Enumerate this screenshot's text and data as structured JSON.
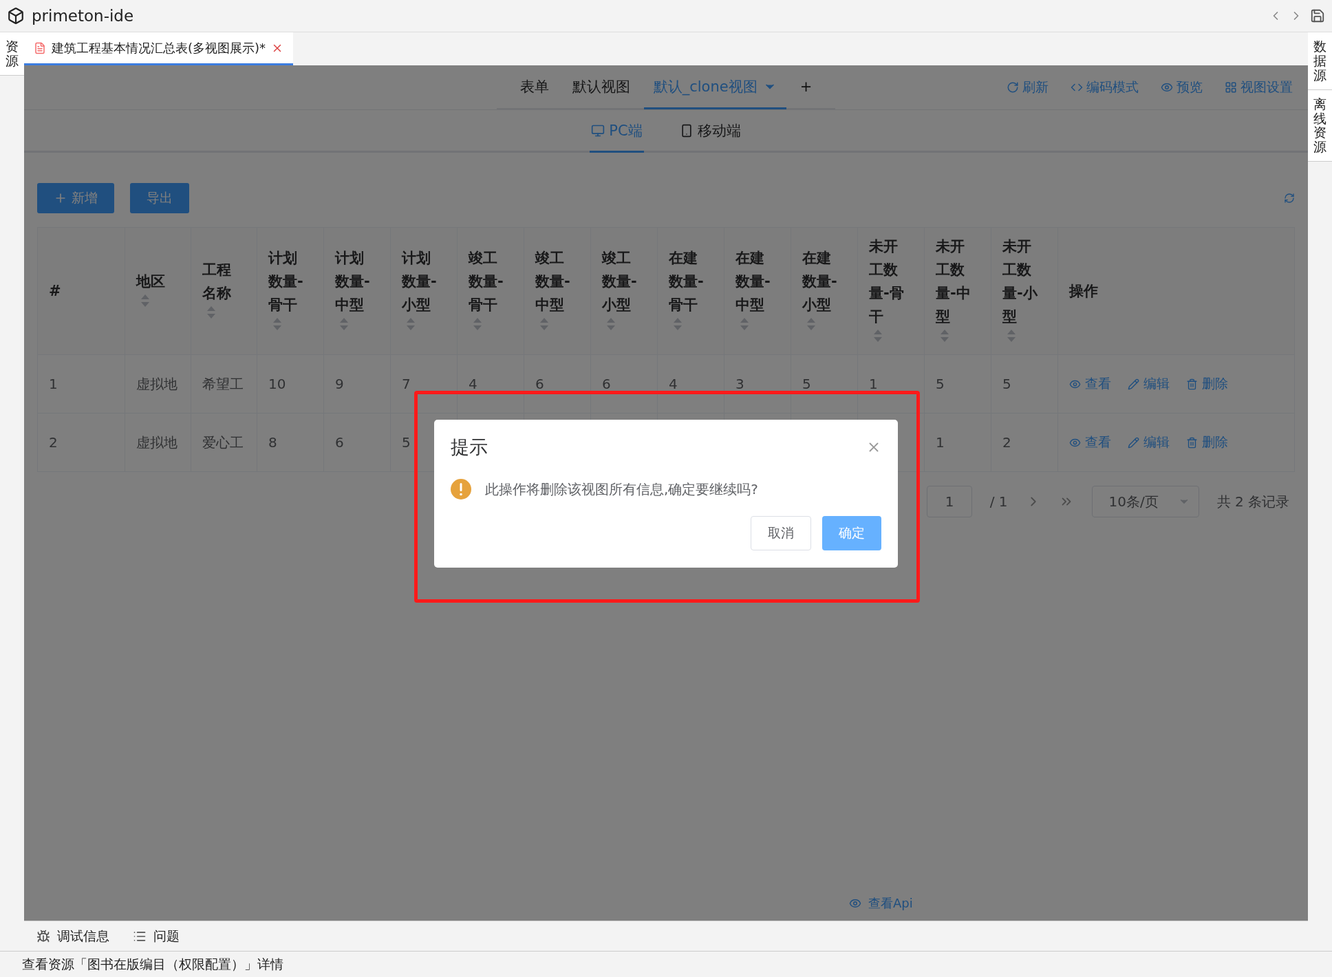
{
  "window": {
    "title": "primeton-ide"
  },
  "left_sidebar": {
    "label": "资源"
  },
  "right_sidebar": [
    {
      "label": "数据源"
    },
    {
      "label": "离线资源"
    }
  ],
  "editor_tab": {
    "title": "建筑工程基本情况汇总表(多视图展示)*",
    "selected": true
  },
  "view_tabs": [
    {
      "label": "表单",
      "selected": false
    },
    {
      "label": "默认视图",
      "selected": false
    },
    {
      "label": "默认_clone视图",
      "selected": true,
      "dropdown": true
    }
  ],
  "add_view": "+",
  "toolbar": [
    {
      "kind": "refresh",
      "label": "刷新"
    },
    {
      "kind": "code",
      "label": "编码模式"
    },
    {
      "kind": "preview",
      "label": "预览"
    },
    {
      "kind": "settings",
      "label": "视图设置"
    }
  ],
  "device_tabs": [
    {
      "kind": "pc",
      "label": "PC端",
      "selected": true
    },
    {
      "kind": "mobile",
      "label": "移动端",
      "selected": false
    }
  ],
  "buttons": [
    {
      "kind": "add",
      "label": "新增"
    },
    {
      "kind": "export",
      "label": "导出"
    }
  ],
  "table": {
    "columns": [
      {
        "label": "#",
        "sortable": false
      },
      {
        "label": "地区",
        "sortable": true
      },
      {
        "label": "工程名称",
        "sortable": true
      },
      {
        "label": "计划数量-骨干",
        "sortable": true
      },
      {
        "label": "计划数量-中型",
        "sortable": true
      },
      {
        "label": "计划数量-小型",
        "sortable": true
      },
      {
        "label": "竣工数量-骨干",
        "sortable": true
      },
      {
        "label": "竣工数量-中型",
        "sortable": true
      },
      {
        "label": "竣工数量-小型",
        "sortable": true
      },
      {
        "label": "在建数量-骨干",
        "sortable": true
      },
      {
        "label": "在建数量-中型",
        "sortable": true
      },
      {
        "label": "在建数量-小型",
        "sortable": true
      },
      {
        "label": "未开工数量-骨干",
        "sortable": true
      },
      {
        "label": "未开工数量-中型",
        "sortable": true
      },
      {
        "label": "未开工数量-小型",
        "sortable": true
      },
      {
        "label": "操作",
        "sortable": false
      }
    ],
    "rows": [
      {
        "cells": [
          "1",
          "虚拟地",
          "希望工",
          "10",
          "9",
          "7",
          "4",
          "6",
          "6",
          "4",
          "3",
          "5",
          "1",
          "5",
          "5"
        ],
        "actions": [
          {
            "kind": "view",
            "label": "查看"
          },
          {
            "kind": "edit",
            "label": "编辑"
          },
          {
            "kind": "delete",
            "label": "删除"
          }
        ]
      },
      {
        "cells": [
          "2",
          "虚拟地",
          "爱心工",
          "8",
          "6",
          "5",
          "",
          "",
          "",
          "",
          "",
          "",
          "",
          "1",
          "2"
        ],
        "actions": [
          {
            "kind": "view",
            "label": "查看"
          },
          {
            "kind": "edit",
            "label": "编辑"
          },
          {
            "kind": "delete",
            "label": "删除"
          }
        ]
      }
    ]
  },
  "pagination": {
    "page": "1",
    "total_pages": "/ 1",
    "page_size": "10条/页",
    "total": "共 2 条记录"
  },
  "api_link": "查看Api",
  "bottom_panel": [
    {
      "kind": "debug",
      "label": "调试信息"
    },
    {
      "kind": "list",
      "label": "问题"
    }
  ],
  "status_bar": "查看资源「图书在版编目（权限配置）」详情",
  "dialog": {
    "title": "提示",
    "message": "此操作将删除该视图所有信息,确定要继续吗?",
    "cancel": "取消",
    "confirm": "确定",
    "highlighted": true
  }
}
